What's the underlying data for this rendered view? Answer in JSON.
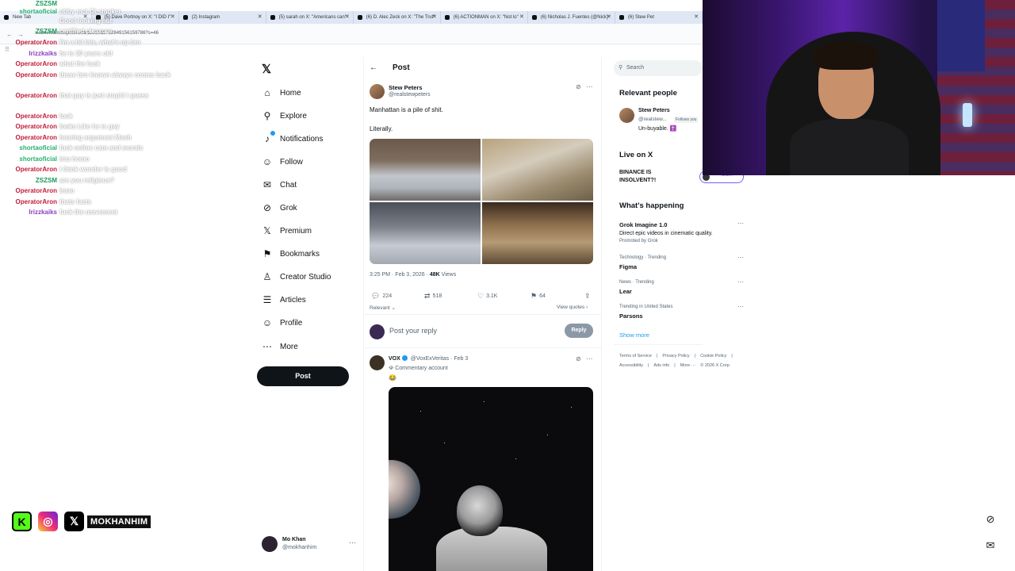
{
  "browser": {
    "tabs": [
      "New Tab",
      "(5) Dave Portnoy on X: \"I DID I\"",
      "(2) Instagram",
      "(5) sarah on X: \"Americans can\"",
      "(6) D. Alec Zeck on X: \"The Trut\"",
      "(6) ACTIONMAN on X: \"Not lo\"",
      "(6) Nicholas J. Fuentes (@Nick)",
      "(6) Stew Pet"
    ],
    "url": "x.com/realstewpeters/status/2018782849156159786?s=46"
  },
  "chat": [
    {
      "user": "ZSZSM",
      "text": "",
      "color": "#1a9a5a"
    },
    {
      "user": "shortaoficial",
      "text": "obby mcLOLsmoker",
      "color": "#26b06f"
    },
    {
      "user": "",
      "text": "Good looking out",
      "color": "#c31d3b"
    },
    {
      "user": "ZSZSM",
      "text": "certified pleasure",
      "color": "#1a9a5a"
    },
    {
      "user": "OperatorAron",
      "text": "I'm a bit late, what's up bro",
      "color": "#c31d3b"
    },
    {
      "user": "Irizzkaiks",
      "text": "he is 30 years old",
      "color": "#8a3fc4"
    },
    {
      "user": "OperatorAron",
      "text": "what the fuck",
      "color": "#c31d3b"
    },
    {
      "user": "OperatorAron",
      "text": "these bro known always comes back",
      "color": "#c31d3b"
    },
    {
      "user": "OperatorAron",
      "text": "that guy is just stupid i guess",
      "color": "#c31d3b"
    },
    {
      "user": "OperatorAron",
      "text": "look",
      "color": "#c31d3b"
    },
    {
      "user": "OperatorAron",
      "text": "looks Like he is gay",
      "color": "#c31d3b"
    },
    {
      "user": "OperatorAron",
      "text": "hearing argument Mosh",
      "color": "#c31d3b"
    },
    {
      "user": "shortaoficial",
      "text": "fuck online cam and morals",
      "color": "#26b06f"
    },
    {
      "user": "shortaoficial",
      "text": "ima homo",
      "color": "#26b06f"
    },
    {
      "user": "OperatorAron",
      "text": "i think wonder is good",
      "color": "#c31d3b"
    },
    {
      "user": "ZSZSM",
      "text": "are you religious?",
      "color": "#1a9a5a"
    },
    {
      "user": "OperatorAron",
      "text": "lmao",
      "color": "#c31d3b"
    },
    {
      "user": "OperatorAron",
      "text": "thats facts",
      "color": "#c31d3b"
    },
    {
      "user": "Irizzkaiks",
      "text": "fuck the movement",
      "color": "#8a3fc4"
    }
  ],
  "nav": {
    "items": [
      {
        "label": "Home",
        "icon": "home-icon",
        "glyph": "⌂"
      },
      {
        "label": "Explore",
        "icon": "search-icon",
        "glyph": "⚲"
      },
      {
        "label": "Notifications",
        "icon": "bell-icon",
        "glyph": "♪"
      },
      {
        "label": "Follow",
        "icon": "person-add-icon",
        "glyph": "☺"
      },
      {
        "label": "Chat",
        "icon": "chat-icon",
        "glyph": "✉"
      },
      {
        "label": "Grok",
        "icon": "grok-icon",
        "glyph": "⊘"
      },
      {
        "label": "Premium",
        "icon": "x-logo-icon",
        "glyph": "𝕏"
      },
      {
        "label": "Bookmarks",
        "icon": "bookmark-icon",
        "glyph": "⚑"
      },
      {
        "label": "Creator Studio",
        "icon": "studio-icon",
        "glyph": "♙"
      },
      {
        "label": "Articles",
        "icon": "articles-icon",
        "glyph": "☰"
      },
      {
        "label": "Profile",
        "icon": "profile-icon",
        "glyph": "☺"
      },
      {
        "label": "More",
        "icon": "more-icon",
        "glyph": "⋯"
      }
    ],
    "post_button": "Post",
    "account": {
      "name": "Mo Khan",
      "handle": "@mokhanhim"
    }
  },
  "post": {
    "header": "Post",
    "author": {
      "name": "Stew Peters",
      "handle": "@realstewpeters"
    },
    "text_line1": "Manhattan is a pile of shit.",
    "text_line2": "Literally.",
    "time": "3:25 PM · Feb 3, 2026 · ",
    "views_count": "48K",
    "views_label": " Views",
    "stats": {
      "replies": "224",
      "reposts": "518",
      "likes": "3.1K",
      "bookmarks": "64"
    },
    "relevant": "Relevant ⌄",
    "view_quotes": "View quotes ›",
    "reply_placeholder": "Post your reply",
    "reply_button": "Reply"
  },
  "reply": {
    "name": "VOX",
    "handle": "@VoxExVeritas · Feb 3",
    "label": "Commentary account",
    "emoji": "😂"
  },
  "sidebar": {
    "search_placeholder": "Search",
    "relevant_title": "Relevant people",
    "person": {
      "name": "Stew Peters",
      "handle": "@realstew...",
      "follows": "Follows you",
      "bio": "Un-buyable. ✝️"
    },
    "live_title": "Live on X",
    "live_item": "BINANCE IS INSOLVENT?!",
    "live_count": "+2.5K",
    "happening_title": "What's happening",
    "trends": [
      {
        "sub": "",
        "title": "Grok Imagine 1.0",
        "desc": "Direct epic videos in cinematic quality.",
        "promo": "Promoted by Grok"
      },
      {
        "sub": "Technology · Trending",
        "title": "Figma",
        "desc": "",
        "promo": ""
      },
      {
        "sub": "News · Trending",
        "title": "Lear",
        "desc": "",
        "promo": ""
      },
      {
        "sub": "Trending in United States",
        "title": "Parsons",
        "desc": "",
        "promo": ""
      }
    ],
    "show_more": "Show more",
    "footer1": [
      "Terms of Service",
      "|",
      "Privacy Policy",
      "|",
      "Cookie Policy",
      "|"
    ],
    "footer2": [
      "Accessibility",
      "|",
      "Ads info",
      "|",
      "More ···",
      "© 2026 X Corp."
    ]
  },
  "overlay": {
    "social_name": "MOKHANHIM"
  }
}
